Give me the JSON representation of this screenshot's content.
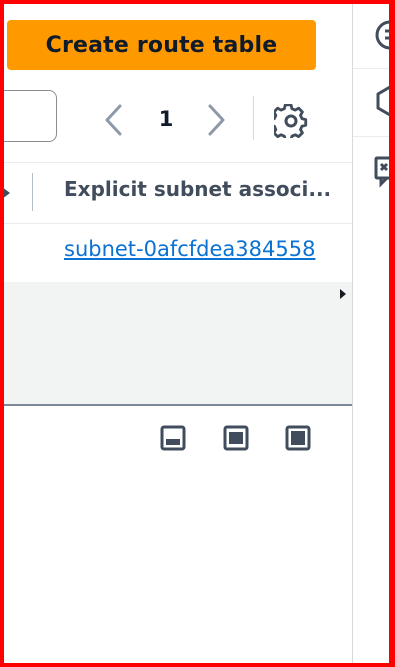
{
  "toolbar": {
    "create_label": "Create route table",
    "search_value": "",
    "page_number": "1"
  },
  "table": {
    "columns": [
      "Explicit subnet associ..."
    ],
    "rows": [
      {
        "explicit_subnet": "subnet-0afcfdea384558"
      }
    ]
  },
  "colors": {
    "primary_button": "#ff9900",
    "link": "#0972d3",
    "text": "#0f1b2a",
    "header_text": "#414d5c",
    "frame": "#ff0000"
  },
  "icons": {
    "pager_prev": "chevron-left-icon",
    "pager_next": "chevron-right-icon",
    "settings": "gear-icon",
    "scroll_right": "caret-right-icon",
    "split_bottom": "panel-bottom-icon",
    "split_side": "panel-side-icon",
    "split_off": "panel-off-icon",
    "rail_info": "info-icon",
    "rail_hex": "hexagon-icon",
    "rail_feedback": "feedback-icon"
  }
}
